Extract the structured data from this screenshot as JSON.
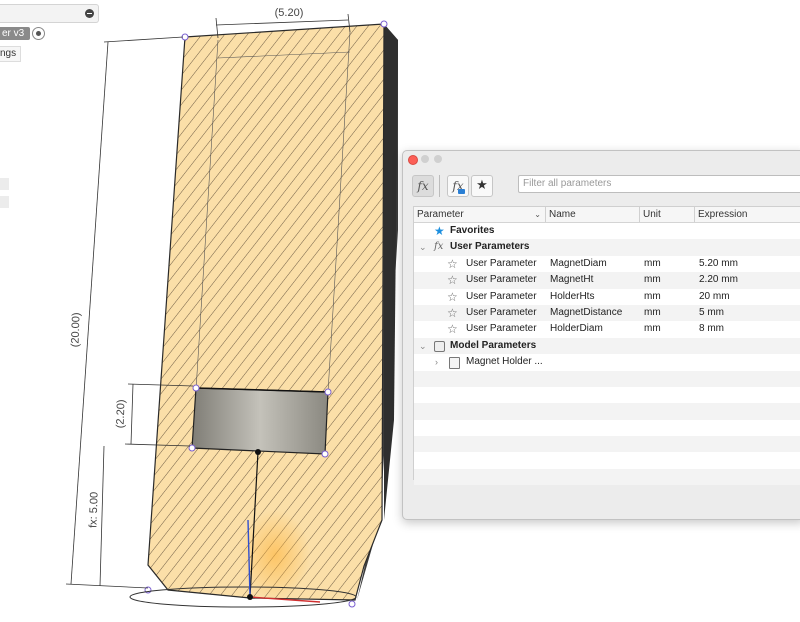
{
  "browser": {
    "component_label": "er v3",
    "settings_label": "ngs"
  },
  "viewport": {
    "dim_width": "(5.20)",
    "dim_height": "(20.00)",
    "dim_slot": "(2.20)",
    "dim_offset": "fx: 5.00"
  },
  "dialog": {
    "search_placeholder": "Filter all parameters",
    "toolbar": {
      "fx_label": "fx",
      "fx2_label": "fx",
      "favorites_icon": "★"
    },
    "columns": [
      "Parameter",
      "Name",
      "Unit",
      "Expression"
    ],
    "groups": {
      "favorites": "Favorites",
      "user": "User Parameters",
      "model": "Model Parameters"
    },
    "rows": [
      {
        "parameter": "User Parameter",
        "name": "MagnetDiam",
        "unit": "mm",
        "expression": "5.20 mm"
      },
      {
        "parameter": "User Parameter",
        "name": "MagnetHt",
        "unit": "mm",
        "expression": "2.20 mm"
      },
      {
        "parameter": "User Parameter",
        "name": "HolderHts",
        "unit": "mm",
        "expression": "20 mm"
      },
      {
        "parameter": "User Parameter",
        "name": "MagnetDistance",
        "unit": "mm",
        "expression": "5 mm"
      },
      {
        "parameter": "User Parameter",
        "name": "HolderDiam",
        "unit": "mm",
        "expression": "8 mm"
      }
    ],
    "model_item": "Magnet Holder ..."
  }
}
